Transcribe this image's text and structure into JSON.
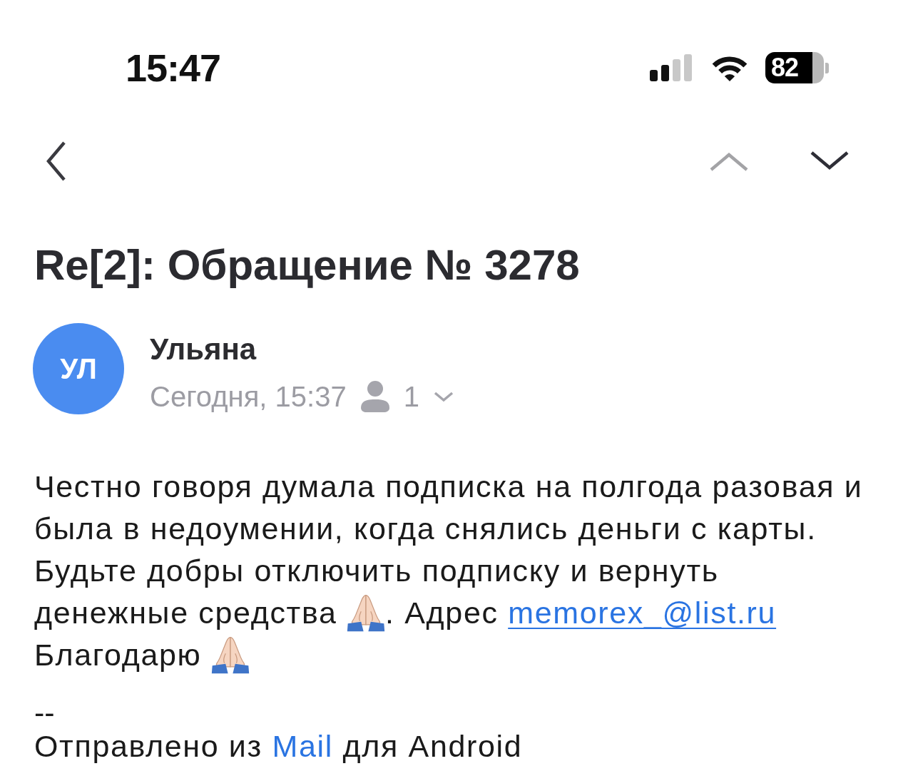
{
  "status_bar": {
    "time": "15:47",
    "battery": "82"
  },
  "navigation": {
    "previous_message": {
      "disabled": true
    },
    "next_message": {
      "disabled": false
    }
  },
  "message": {
    "subject": "Re[2]: Обращение № 3278",
    "sender": {
      "initials": "УЛ",
      "name": "Ульяна"
    },
    "date": "Сегодня, 15:37",
    "recipients_count": "1",
    "body": [
      {
        "segments": [
          {
            "kind": "text",
            "text": "Честно говоря думала подписка на полгода разовая и была в недоумении, когда снялись деньги с карты. Будьте добры отключить подписку и вернуть денежные средства "
          },
          {
            "kind": "emoji"
          },
          {
            "kind": "text",
            "text": ". Адрес "
          },
          {
            "kind": "link",
            "text": "memorex_@list.ru"
          }
        ]
      },
      {
        "segments": [
          {
            "kind": "text",
            "text": "Благодарю "
          },
          {
            "kind": "emoji"
          }
        ]
      }
    ],
    "signature": {
      "separator": "--",
      "segments": [
        {
          "kind": "text",
          "text": "Отправлено из "
        },
        {
          "kind": "link",
          "text": "Mail"
        },
        {
          "kind": "text",
          "text": " для Android"
        }
      ]
    }
  }
}
